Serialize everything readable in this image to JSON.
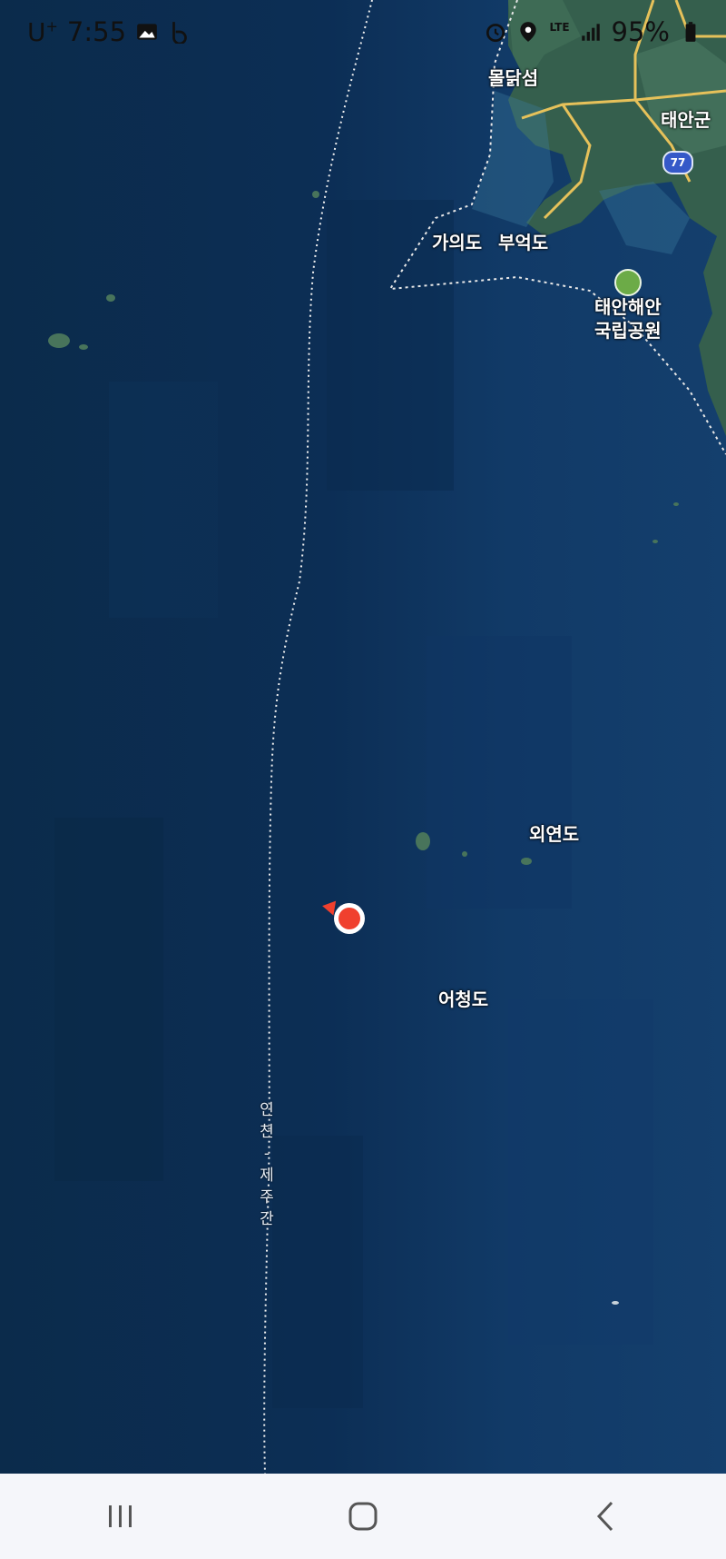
{
  "status_bar": {
    "carrier": "U",
    "carrier_sup": "+",
    "time": "7:55",
    "network": "LTE",
    "battery": "95%",
    "icons": [
      "gallery-icon",
      "b-app-icon",
      "alarm-icon",
      "location-icon",
      "signal-icon",
      "battery-icon"
    ]
  },
  "map": {
    "labels": {
      "mulsum": "몰닭섬",
      "taean_gun": "태안군",
      "gaui_do": "가의도",
      "bueok_do": "부억도",
      "park_line1": "태안해안",
      "park_line2": "국립공원",
      "oeyeon_do": "외연도",
      "eocheong_do": "어청도",
      "route_chars": [
        "인",
        "천",
        "-",
        "제",
        "주",
        "간"
      ],
      "road_number": "77"
    },
    "colors": {
      "sea": "#0c2e55",
      "land": "#355f4d",
      "road": "#e6c15a",
      "marker": "#f0402e",
      "park": "#6cab47"
    }
  },
  "nav_bar": {
    "recent_label": "recent-apps",
    "home_label": "home",
    "back_label": "back"
  }
}
